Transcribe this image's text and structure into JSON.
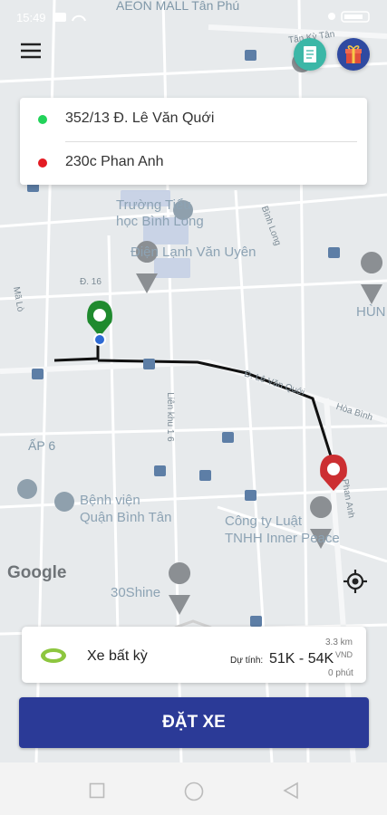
{
  "status_bar": {
    "time": "15:49"
  },
  "search": {
    "pickup": "352/13 Đ. Lê Văn Quới",
    "destination": "230c Phan Anh"
  },
  "map": {
    "labels": {
      "aeon": "AEON MALL Tân Phú",
      "tan_ky": "Tân Kỳ Tân",
      "school": "Trường Tiểu\nhọc Bình Long",
      "school_l1": "Trường Tiểu",
      "school_l2": "học Bình Long",
      "dien_lanh": "Điện Lạnh Văn Uyên",
      "hun": "HÙN",
      "ma_lo": "Mã Lò",
      "d16": "Đ. 16",
      "binh_long": "Bình Long",
      "le_van_quoi": "Đ. Lê Văn Quới",
      "hoa_binh": "Hòa Bình",
      "lien_khu": "Liên khu 1 6",
      "ap6": "ẤP 6",
      "hospital_l1": "Bệnh viện",
      "hospital_l2": "Quận Bình Tân",
      "phan_anh": "Phan Anh",
      "law_l1": "Công ty Luật",
      "law_l2": "TNHH Inner Peace",
      "shine": "30Shine",
      "google": "Google"
    }
  },
  "ride": {
    "name": "Xe bất kỳ",
    "price_label": "Dự tính:",
    "price": "51K - 54K",
    "currency": "VND",
    "distance": "3.3 km",
    "duration": "0 phút"
  },
  "book_button": "ĐẶT XE",
  "colors": {
    "primary": "#2b3a97",
    "pickup": "#22d35a",
    "destination": "#e31b23",
    "pickup_pin": "#1f8a2e",
    "destination_pin": "#cc2f32",
    "route": "#111111"
  }
}
